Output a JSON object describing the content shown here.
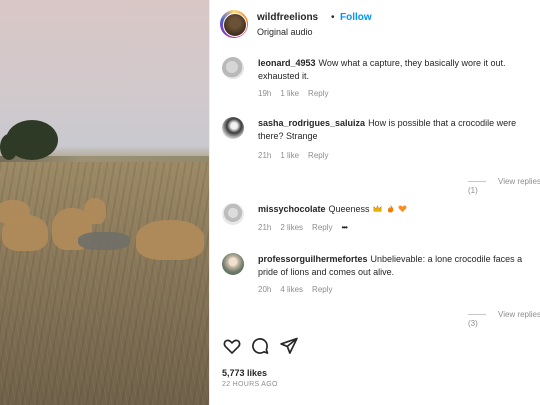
{
  "header": {
    "username": "wildfreelions",
    "separator": "•",
    "follow_label": "Follow",
    "audio_label": "Original audio"
  },
  "comments": [
    {
      "user": "leonard_4953",
      "text": "Wow what a capture, they basically wore it out. exhausted it.",
      "time": "19h",
      "likes": "1 like",
      "reply": "Reply",
      "avatar": "grey-blurred-avatar"
    },
    {
      "user": "sasha_rodrigues_saluiza",
      "text": "How is possible that a crocodile were there? Strange",
      "time": "21h",
      "likes": "1 like",
      "reply": "Reply",
      "avatar": "black-white-portrait-avatar",
      "view_replies": "View replies (1)"
    },
    {
      "user": "missychocolate",
      "text": "Queeness",
      "time": "21h",
      "likes": "2 likes",
      "reply": "Reply",
      "more": "•••",
      "avatar": "grey-blurred-avatar",
      "emojis": [
        "crown",
        "fire",
        "orange-heart"
      ]
    },
    {
      "user": "professorguilhermefortes",
      "text": "Unbelievable: a lone crocodile faces a pride of lions and comes out alive.",
      "time": "20h",
      "likes": "4 likes",
      "reply": "Reply",
      "avatar": "older-man-portrait-avatar",
      "view_replies": "View replies (3)"
    }
  ],
  "actions": {
    "icons": [
      "heart-icon",
      "comment-icon",
      "share-icon"
    ]
  },
  "footer": {
    "likes": "5,773 likes",
    "time_ago": "22 HOURS AGO"
  },
  "colors": {
    "accent": "#0095f6",
    "muted": "#8e8e8e",
    "text": "#262626"
  }
}
